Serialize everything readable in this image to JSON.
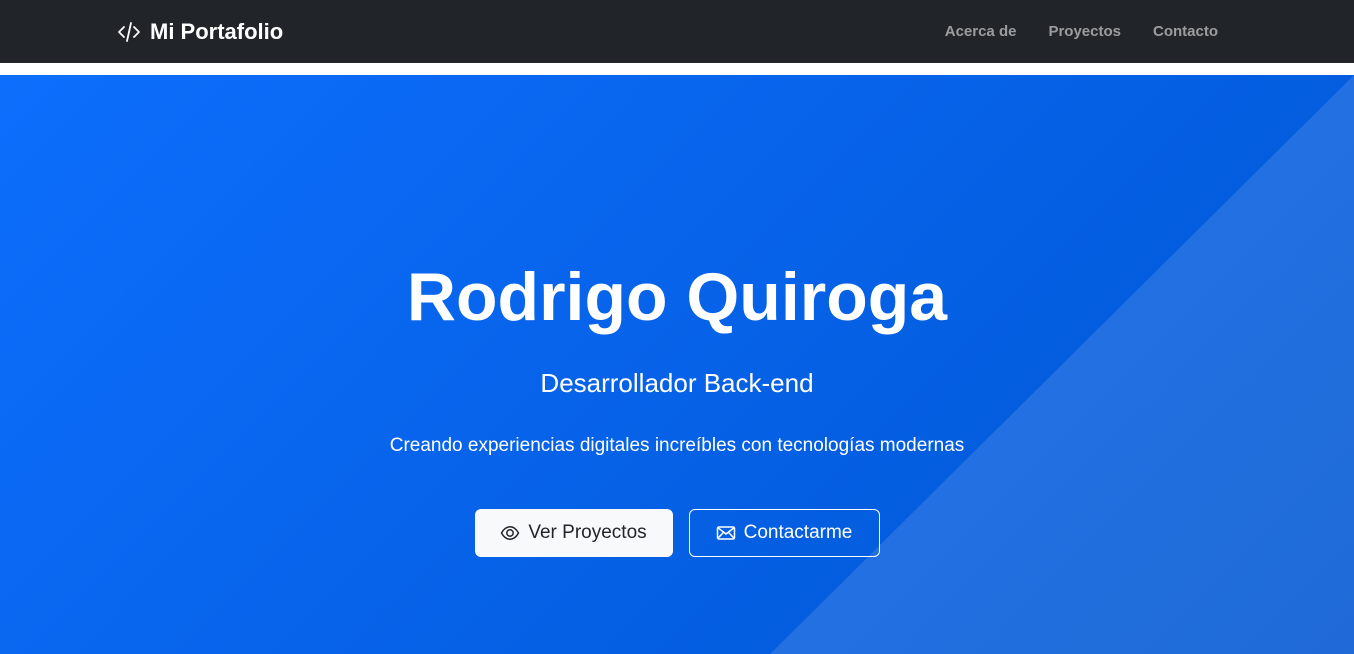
{
  "navbar": {
    "brand": "Mi Portafolio",
    "brand_icon": "code-slash-icon",
    "links": [
      {
        "label": "Acerca de"
      },
      {
        "label": "Proyectos"
      },
      {
        "label": "Contacto"
      }
    ]
  },
  "hero": {
    "title": "Rodrigo Quiroga",
    "subtitle": "Desarrollador Back-end",
    "tagline": "Creando experiencias digitales increíbles con tecnologías modernas",
    "buttons": {
      "projects": {
        "label": "Ver Proyectos",
        "icon": "eye-icon"
      },
      "contact": {
        "label": "Contactarme",
        "icon": "envelope-icon"
      }
    }
  },
  "colors": {
    "navbar_bg": "#212529",
    "hero_gradient_start": "#0d6efd",
    "hero_gradient_end": "#0056d2",
    "button_light": "#f8f9fa"
  }
}
